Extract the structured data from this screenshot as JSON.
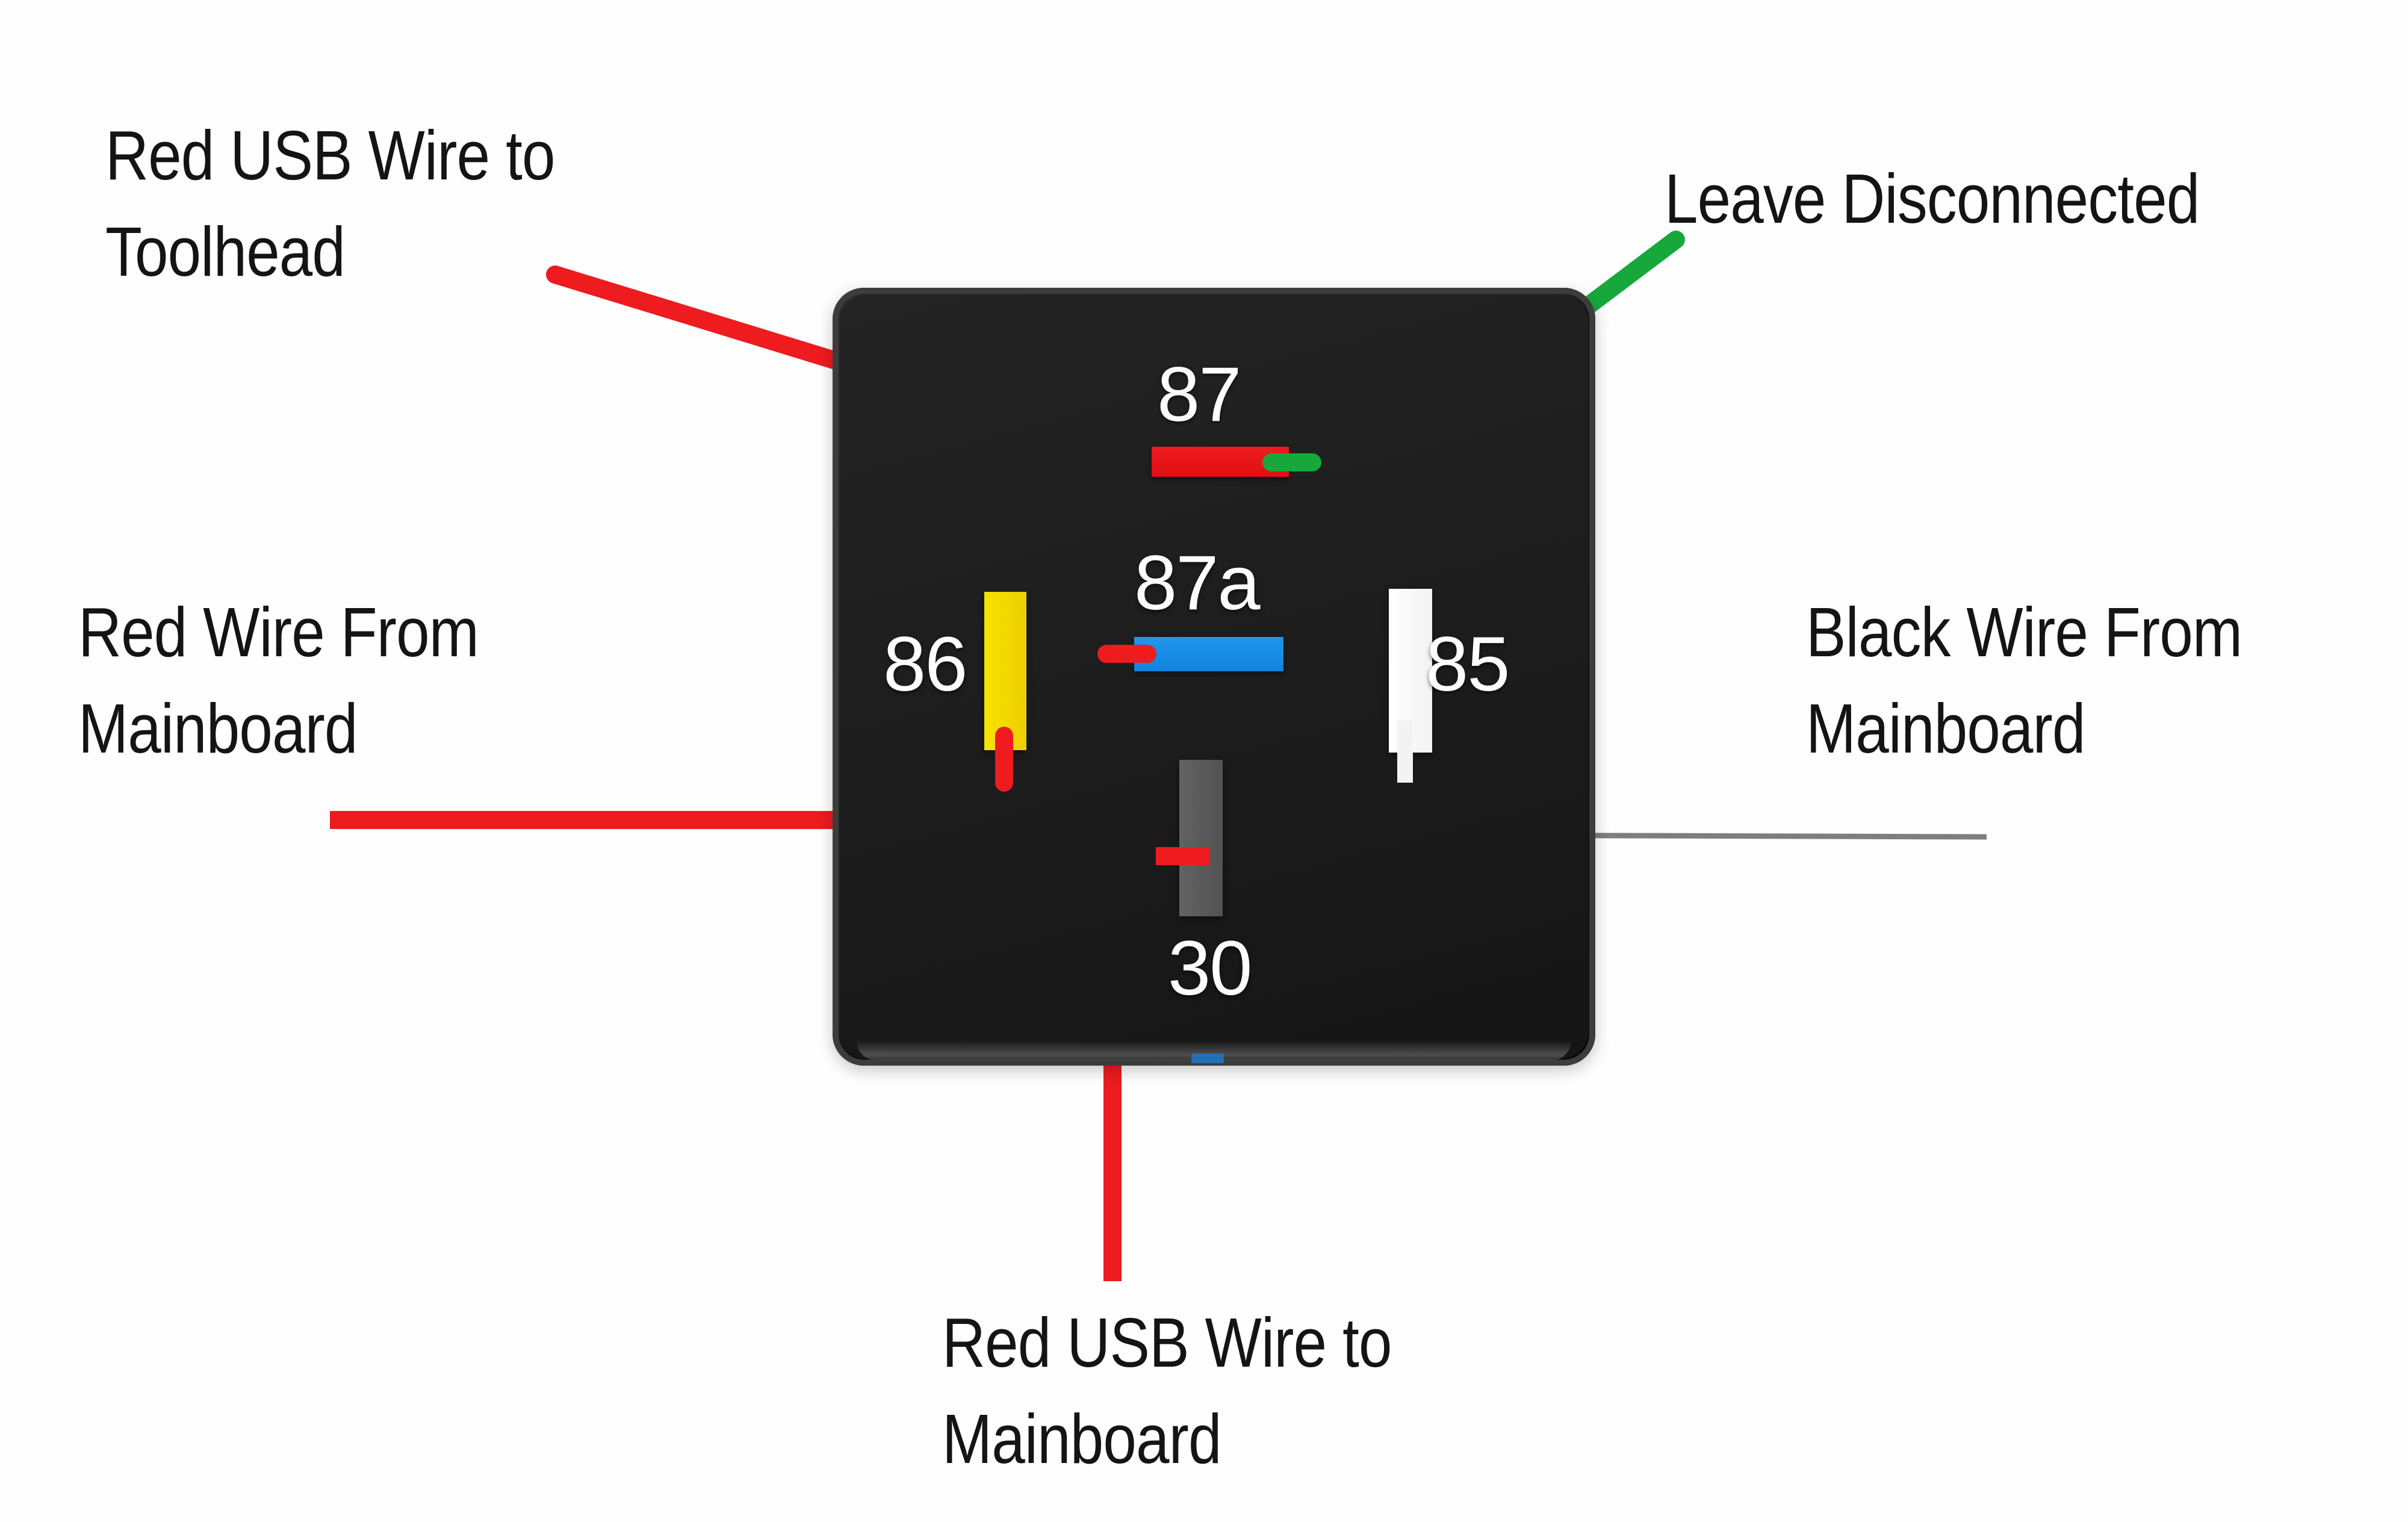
{
  "diagram": {
    "title": "Automotive relay wiring diagram",
    "background_color": "#ffffff"
  },
  "relay": {
    "body_color": "#1e1e1e",
    "bevel_color": "#3c3c3c",
    "terminals": [
      {
        "id": "87",
        "label": "87",
        "color": "#e8161a",
        "orientation": "horizontal",
        "label_position": "above"
      },
      {
        "id": "87a",
        "label": "87a",
        "color": "#1e90e8",
        "orientation": "horizontal",
        "label_position": "above"
      },
      {
        "id": "86",
        "label": "86",
        "color": "#f5dd00",
        "orientation": "vertical",
        "label_position": "left"
      },
      {
        "id": "85",
        "label": "85",
        "color": "#ffffff",
        "orientation": "vertical",
        "label_position": "right"
      },
      {
        "id": "30",
        "label": "30",
        "color": "#5a5a5a",
        "orientation": "vertical",
        "label_position": "below"
      }
    ]
  },
  "wires": [
    {
      "id": "red-usb-toolhead",
      "color": "#ee1b1f",
      "connects_to": "87a",
      "note": "enters from upper left"
    },
    {
      "id": "green-disconnected",
      "color": "#16a83a",
      "connects_to": "87",
      "note": "exits to upper right"
    },
    {
      "id": "red-from-mainboard",
      "color": "#ee1b1f",
      "connects_to": "86",
      "note": "enters from left"
    },
    {
      "id": "black-from-mainboard",
      "color": "#d8d8d8",
      "connects_to": "85",
      "note": "exits to right, thin gray lead"
    },
    {
      "id": "red-usb-mainboard",
      "color": "#ee1b1f",
      "connects_to": "30",
      "note": "exits downward"
    }
  ],
  "annotations": {
    "red_usb_to_toolhead": "Red USB Wire to\nToolhead",
    "leave_disconnected": "Leave Disconnected",
    "red_wire_from_mainboard": "Red Wire From\nMainboard",
    "black_wire_from_mainboard": "Black Wire From\nMainboard",
    "red_usb_to_mainboard": "Red USB Wire to\nMainboard"
  }
}
